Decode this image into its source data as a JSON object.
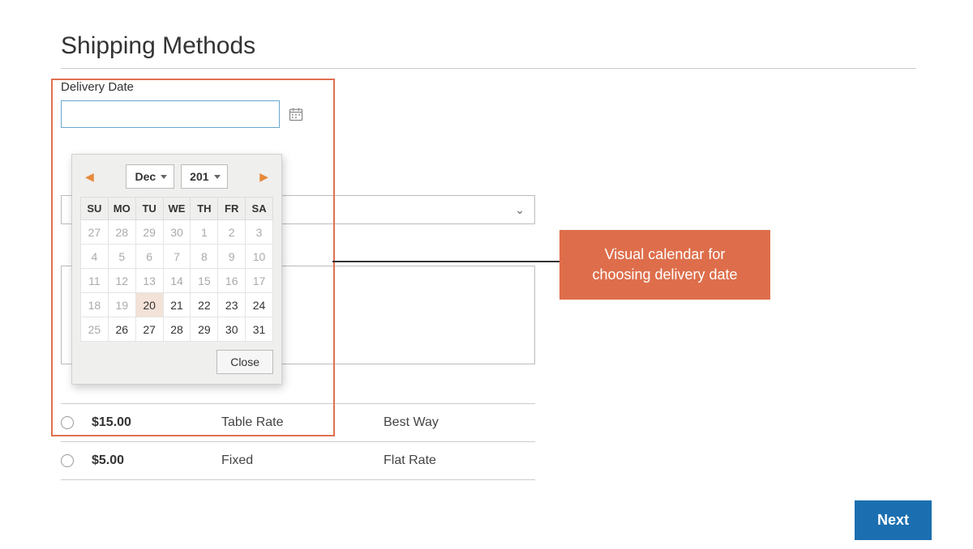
{
  "page": {
    "title": "Shipping Methods"
  },
  "delivery_date": {
    "label": "Delivery Date",
    "value": ""
  },
  "datepicker": {
    "month": "Dec",
    "year": "201",
    "close_label": "Close",
    "day_headers": [
      "SU",
      "MO",
      "TU",
      "WE",
      "TH",
      "FR",
      "SA"
    ],
    "weeks": [
      [
        {
          "d": "27",
          "cls": "other"
        },
        {
          "d": "28",
          "cls": "other"
        },
        {
          "d": "29",
          "cls": "other"
        },
        {
          "d": "30",
          "cls": "other"
        },
        {
          "d": "1",
          "cls": "past"
        },
        {
          "d": "2",
          "cls": "past"
        },
        {
          "d": "3",
          "cls": "past"
        }
      ],
      [
        {
          "d": "4",
          "cls": "past"
        },
        {
          "d": "5",
          "cls": "past"
        },
        {
          "d": "6",
          "cls": "past"
        },
        {
          "d": "7",
          "cls": "past"
        },
        {
          "d": "8",
          "cls": "past"
        },
        {
          "d": "9",
          "cls": "past"
        },
        {
          "d": "10",
          "cls": "past"
        }
      ],
      [
        {
          "d": "11",
          "cls": "past"
        },
        {
          "d": "12",
          "cls": "past"
        },
        {
          "d": "13",
          "cls": "past"
        },
        {
          "d": "14",
          "cls": "past"
        },
        {
          "d": "15",
          "cls": "past"
        },
        {
          "d": "16",
          "cls": "past"
        },
        {
          "d": "17",
          "cls": "past"
        }
      ],
      [
        {
          "d": "18",
          "cls": "past"
        },
        {
          "d": "19",
          "cls": "past"
        },
        {
          "d": "20",
          "cls": "today"
        },
        {
          "d": "21",
          "cls": ""
        },
        {
          "d": "22",
          "cls": ""
        },
        {
          "d": "23",
          "cls": ""
        },
        {
          "d": "24",
          "cls": ""
        }
      ],
      [
        {
          "d": "25",
          "cls": "past"
        },
        {
          "d": "26",
          "cls": ""
        },
        {
          "d": "27",
          "cls": ""
        },
        {
          "d": "28",
          "cls": ""
        },
        {
          "d": "29",
          "cls": ""
        },
        {
          "d": "30",
          "cls": ""
        },
        {
          "d": "31",
          "cls": ""
        }
      ]
    ]
  },
  "shipping_methods": [
    {
      "price": "$15.00",
      "method": "Table Rate",
      "carrier": "Best Way"
    },
    {
      "price": "$5.00",
      "method": "Fixed",
      "carrier": "Flat Rate"
    }
  ],
  "annotation": {
    "text": "Visual calendar for choosing delivery date"
  },
  "buttons": {
    "next": "Next"
  }
}
